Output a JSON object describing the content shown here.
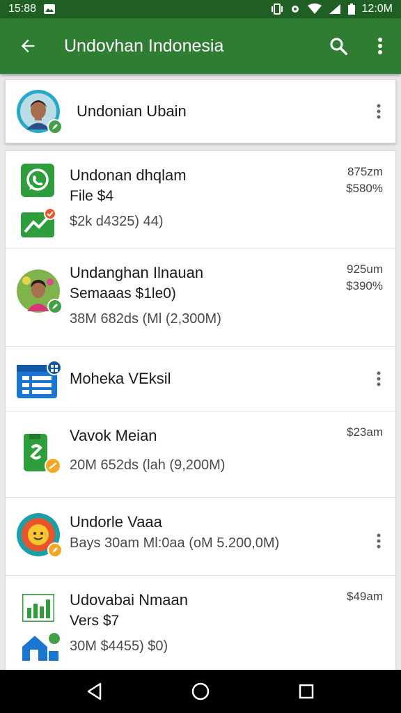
{
  "status_bar": {
    "time_left": "15:88",
    "time_right": "12:0M"
  },
  "app_bar": {
    "title": "Undovhan Indonesia"
  },
  "pinned": {
    "name": "Undonian Ubain"
  },
  "rows": [
    {
      "line1": "Undonan dhqlam",
      "line2": "File $4",
      "line3": "$2k d4325) 44)",
      "meta1": "875zm",
      "meta2": "$580%"
    },
    {
      "line1": "Undanghan Ilnauan",
      "line2": "Semaaas $1le0)",
      "line3": "38M 682ds (Ml (2,300M)",
      "meta1": "925um",
      "meta2": "$390%"
    },
    {
      "line1": "Moheka VEksil"
    },
    {
      "line1": "Vavok Meian",
      "line3": "20M 652ds (lah (9,200M)",
      "meta1": "$23am"
    },
    {
      "line1": "Undorle Vaaa",
      "line3": "Bays 30am Ml:0aa (oM 5.200,0M)"
    },
    {
      "line1": "Udovabai Nmaan",
      "line2": "Vers $7",
      "line3": "30M $4455) $0)",
      "meta1": "$49am"
    }
  ],
  "colors": {
    "primary": "#2e7d32",
    "primary_dark": "#1f5f23",
    "badge_green": "#43a047",
    "badge_orange": "#f5a623",
    "badge_red": "#e8542b",
    "calendar_blue": "#1976d2"
  },
  "icons": {
    "back": "arrow-back-icon",
    "search": "search-icon",
    "more": "more-vert-icon",
    "nav_back": "triangle-back-icon",
    "nav_home": "circle-home-icon",
    "nav_recent": "square-recent-icon"
  }
}
